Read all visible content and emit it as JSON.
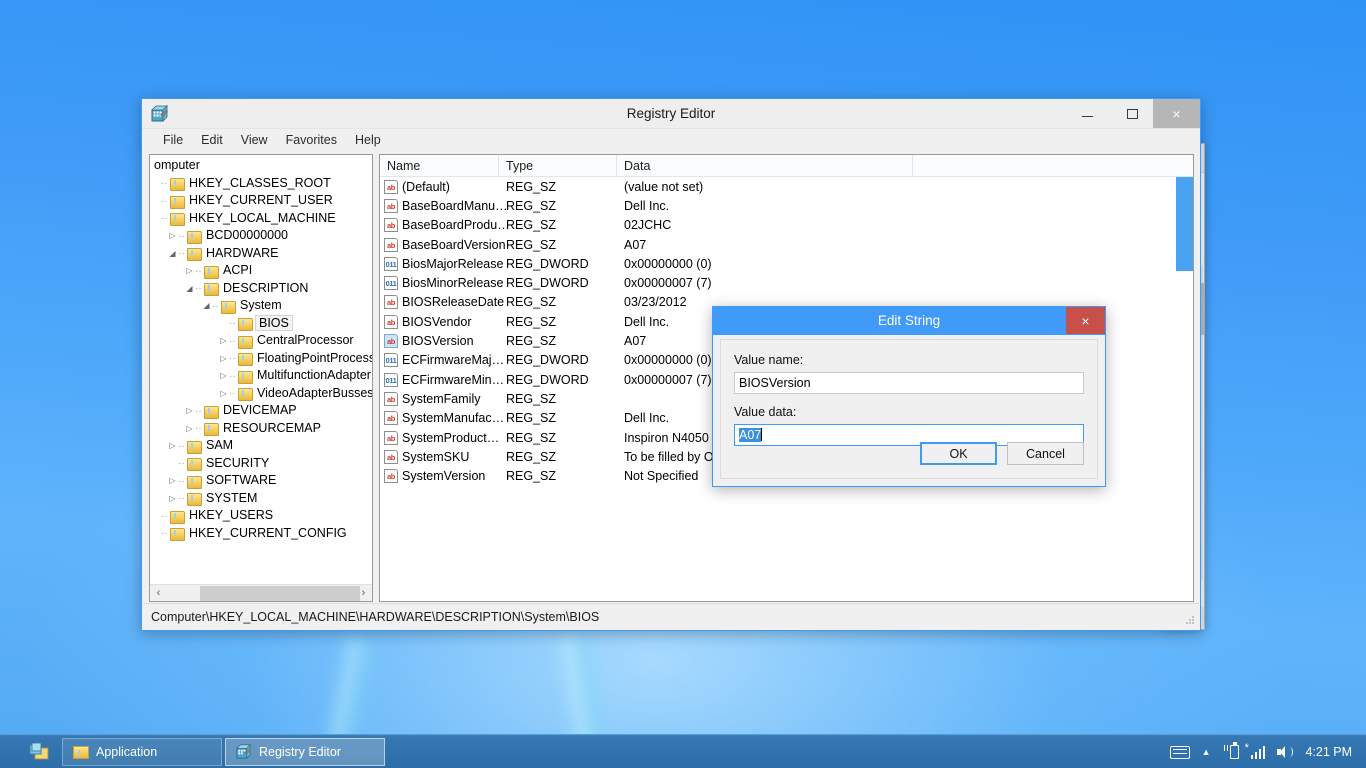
{
  "window": {
    "title": "Registry Editor",
    "app_icon": "registry-editor-icon",
    "controls": {
      "minimize": "–",
      "maximize": "□",
      "close": "×"
    },
    "menu": [
      "File",
      "Edit",
      "View",
      "Favorites",
      "Help"
    ],
    "statusbar": "Computer\\HKEY_LOCAL_MACHINE\\HARDWARE\\DESCRIPTION\\System\\BIOS"
  },
  "tree": {
    "root_label": "omputer",
    "nodes": [
      {
        "label": "HKEY_CLASSES_ROOT",
        "indent": 0,
        "expander": "",
        "selected": false
      },
      {
        "label": "HKEY_CURRENT_USER",
        "indent": 0,
        "expander": "",
        "selected": false
      },
      {
        "label": "HKEY_LOCAL_MACHINE",
        "indent": 0,
        "expander": "",
        "selected": false
      },
      {
        "label": "BCD00000000",
        "indent": 1,
        "expander": "▷",
        "selected": false
      },
      {
        "label": "HARDWARE",
        "indent": 1,
        "expander": "◢",
        "selected": false
      },
      {
        "label": "ACPI",
        "indent": 2,
        "expander": "▷",
        "selected": false
      },
      {
        "label": "DESCRIPTION",
        "indent": 2,
        "expander": "◢",
        "selected": false
      },
      {
        "label": "System",
        "indent": 3,
        "expander": "◢",
        "selected": false
      },
      {
        "label": "BIOS",
        "indent": 4,
        "expander": "",
        "selected": true
      },
      {
        "label": "CentralProcessor",
        "indent": 4,
        "expander": "▷",
        "selected": false
      },
      {
        "label": "FloatingPointProcessor",
        "indent": 4,
        "expander": "▷",
        "selected": false
      },
      {
        "label": "MultifunctionAdapter",
        "indent": 4,
        "expander": "▷",
        "selected": false
      },
      {
        "label": "VideoAdapterBusses",
        "indent": 4,
        "expander": "▷",
        "selected": false
      },
      {
        "label": "DEVICEMAP",
        "indent": 2,
        "expander": "▷",
        "selected": false
      },
      {
        "label": "RESOURCEMAP",
        "indent": 2,
        "expander": "▷",
        "selected": false
      },
      {
        "label": "SAM",
        "indent": 1,
        "expander": "▷",
        "selected": false
      },
      {
        "label": "SECURITY",
        "indent": 1,
        "expander": "",
        "selected": false
      },
      {
        "label": "SOFTWARE",
        "indent": 1,
        "expander": "▷",
        "selected": false
      },
      {
        "label": "SYSTEM",
        "indent": 1,
        "expander": "▷",
        "selected": false
      },
      {
        "label": "HKEY_USERS",
        "indent": 0,
        "expander": "",
        "selected": false
      },
      {
        "label": "HKEY_CURRENT_CONFIG",
        "indent": 0,
        "expander": "",
        "selected": false
      }
    ],
    "hscroll": {
      "left_arrow": "‹",
      "right_arrow": "›"
    }
  },
  "list": {
    "columns": [
      "Name",
      "Type",
      "Data"
    ],
    "rows": [
      {
        "name": "(Default)",
        "type": "REG_SZ",
        "data": "(value not set)",
        "icon": "sz",
        "selected": false
      },
      {
        "name": "BaseBoardManu…",
        "type": "REG_SZ",
        "data": "Dell Inc.",
        "icon": "sz",
        "selected": false
      },
      {
        "name": "BaseBoardProdu…",
        "type": "REG_SZ",
        "data": "02JCHC",
        "icon": "sz",
        "selected": false
      },
      {
        "name": "BaseBoardVersion",
        "type": "REG_SZ",
        "data": "A07",
        "icon": "sz",
        "selected": false
      },
      {
        "name": "BiosMajorRelease",
        "type": "REG_DWORD",
        "data": "0x00000000 (0)",
        "icon": "dw",
        "selected": false
      },
      {
        "name": "BiosMinorRelease",
        "type": "REG_DWORD",
        "data": "0x00000007 (7)",
        "icon": "dw",
        "selected": false
      },
      {
        "name": "BIOSReleaseDate",
        "type": "REG_SZ",
        "data": "03/23/2012",
        "icon": "sz",
        "selected": false
      },
      {
        "name": "BIOSVendor",
        "type": "REG_SZ",
        "data": "Dell Inc.",
        "icon": "sz",
        "selected": false
      },
      {
        "name": "BIOSVersion",
        "type": "REG_SZ",
        "data": "A07",
        "icon": "sz",
        "selected": true
      },
      {
        "name": "ECFirmwareMaj…",
        "type": "REG_DWORD",
        "data": "0x00000000 (0)",
        "icon": "dw",
        "selected": false
      },
      {
        "name": "ECFirmwareMin…",
        "type": "REG_DWORD",
        "data": "0x00000007 (7)",
        "icon": "dw",
        "selected": false
      },
      {
        "name": "SystemFamily",
        "type": "REG_SZ",
        "data": "",
        "icon": "sz",
        "selected": false
      },
      {
        "name": "SystemManufac…",
        "type": "REG_SZ",
        "data": "Dell Inc.",
        "icon": "sz",
        "selected": false
      },
      {
        "name": "SystemProduct…",
        "type": "REG_SZ",
        "data": "Inspiron N4050",
        "icon": "sz",
        "selected": false
      },
      {
        "name": "SystemSKU",
        "type": "REG_SZ",
        "data": "To be filled by O.E.M.",
        "icon": "sz",
        "selected": false
      },
      {
        "name": "SystemVersion",
        "type": "REG_SZ",
        "data": "Not Specified",
        "icon": "sz",
        "selected": false
      }
    ]
  },
  "dialog": {
    "title": "Edit String",
    "close_glyph": "×",
    "value_name_label": "Value name:",
    "value_name": "BIOSVersion",
    "value_data_label": "Value data:",
    "value_data": "A07",
    "ok_label": "OK",
    "cancel_label": "Cancel"
  },
  "background_window": {
    "close_glyph": "×",
    "help_glyph": "?",
    "scroll_up": "⌃",
    "scroll_down": "⌄"
  },
  "taskbar": {
    "tasks": [
      {
        "label": "Application",
        "icon": "folder-icon",
        "active": false
      },
      {
        "label": "Registry Editor",
        "icon": "registry-editor-icon",
        "active": true
      }
    ],
    "tray": {
      "keyboard_icon": "keyboard-icon",
      "overflow_glyph": "▲",
      "battery_icon": "battery-charging-icon",
      "network_icon": "wifi-signal-icon",
      "volume_icon": "speaker-icon",
      "clock": "4:21 PM"
    }
  },
  "colors": {
    "accent": "#3f9bf7",
    "dialog_close": "#c7514a",
    "selection": "#3a8fe0",
    "taskbar": "#2d6ea8"
  }
}
